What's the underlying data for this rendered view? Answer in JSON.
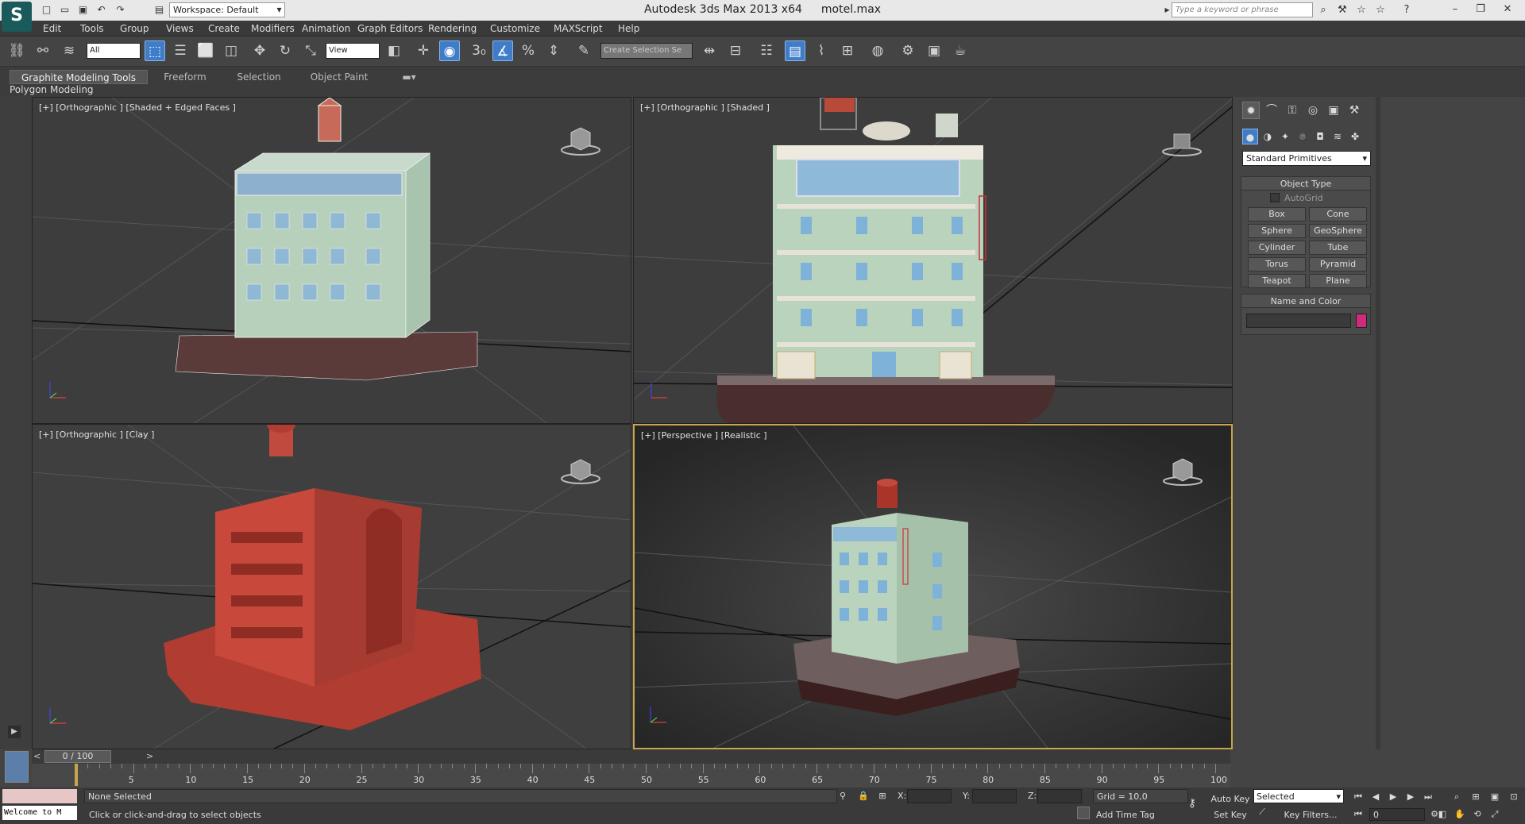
{
  "app": {
    "title": "Autodesk 3ds Max  2013 x64",
    "file": "motel.max",
    "workspace": "Workspace: Default",
    "search_placeholder": "Type a keyword or phrase"
  },
  "menu": [
    "Edit",
    "Tools",
    "Group",
    "Views",
    "Create",
    "Modifiers",
    "Animation",
    "Graph Editors",
    "Rendering",
    "Customize",
    "MAXScript",
    "Help"
  ],
  "toolbar": {
    "selection_filter": "All",
    "ref_coord": "View",
    "named_selection": "Create Selection Se",
    "snap_3": "3",
    "angle_snap": "%"
  },
  "ribbon": {
    "tabs": [
      "Graphite Modeling Tools",
      "Freeform",
      "Selection",
      "Object Paint"
    ],
    "subpanel": "Polygon Modeling"
  },
  "viewports": {
    "top_left": "[+] [Orthographic ] [Shaded + Edged Faces ]",
    "top_right": "[+] [Orthographic ] [Shaded ]",
    "bottom_left": "[+] [Orthographic ] [Clay ]",
    "bottom_right": "[+] [Perspective ] [Realistic ]"
  },
  "command_panel": {
    "dropdown": "Standard Primitives",
    "object_type": {
      "header": "Object Type",
      "autogrid": "AutoGrid",
      "buttons": [
        "Box",
        "Cone",
        "Sphere",
        "GeoSphere",
        "Cylinder",
        "Tube",
        "Torus",
        "Pyramid",
        "Teapot",
        "Plane"
      ]
    },
    "name_color": {
      "header": "Name and Color",
      "name": "",
      "color": "#d02a7a"
    }
  },
  "timeline": {
    "slider": "0 / 100",
    "ticks": [
      "5",
      "10",
      "15",
      "20",
      "25",
      "30",
      "35",
      "40",
      "45",
      "50",
      "55",
      "60",
      "65",
      "70",
      "75",
      "80",
      "85",
      "90",
      "95",
      "100"
    ]
  },
  "status": {
    "listener": "Welcome to M",
    "selection": "None Selected",
    "prompt": "Click or click-and-drag to select objects",
    "x_label": "X:",
    "y_label": "Y:",
    "z_label": "Z:",
    "grid": "Grid = 10,0",
    "add_time_tag": "Add Time Tag",
    "auto_key": "Auto Key",
    "set_key": "Set Key",
    "key_mode": "Selected",
    "key_filters": "Key Filters...",
    "frame": "0"
  },
  "colors": {
    "accent": "#3f7dc8",
    "viewport_bg": "#3d3d3d",
    "active_viewport_border": "#c8a54a",
    "clay": "#c8483c",
    "building_green": "#b9d3bd"
  }
}
